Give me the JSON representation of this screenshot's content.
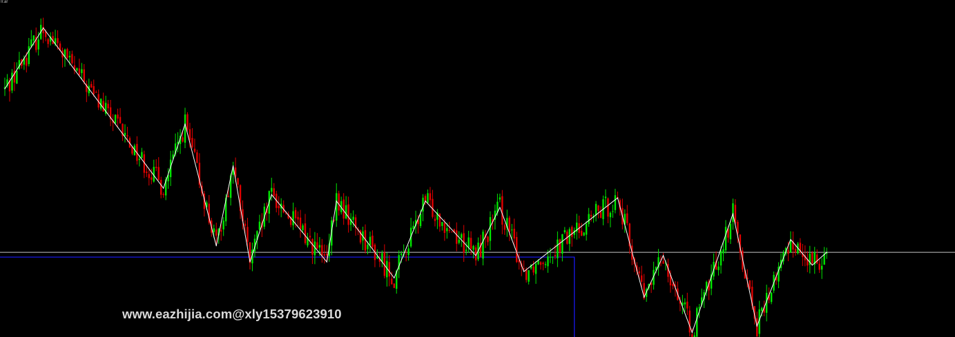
{
  "window": {
    "corner_label": "Ir.ar"
  },
  "watermark": {
    "text": "www.eazhijia.com@xly15379623910"
  },
  "colors": {
    "background": "#000000",
    "bull_candle": "#00e600",
    "bear_candle": "#e00000",
    "zigzag": "#ffffff",
    "horizontal_line": "#c8c8c8",
    "box_outline": "#1a1aff"
  },
  "chart_data": {
    "type": "candlestick",
    "title": "",
    "xlabel": "",
    "ylabel": "",
    "y_scale": "price (unlabeled)",
    "ylim": [
      0,
      100
    ],
    "grid": false,
    "legend": "none",
    "overlays": {
      "zigzag_pivots": [
        {
          "bar": 0,
          "value": 77
        },
        {
          "bar": 16,
          "value": 96
        },
        {
          "bar": 66,
          "value": 46
        },
        {
          "bar": 75,
          "value": 66
        },
        {
          "bar": 88,
          "value": 28
        },
        {
          "bar": 95,
          "value": 53
        },
        {
          "bar": 102,
          "value": 23
        },
        {
          "bar": 111,
          "value": 44
        },
        {
          "bar": 134,
          "value": 23
        },
        {
          "bar": 138,
          "value": 42
        },
        {
          "bar": 162,
          "value": 18
        },
        {
          "bar": 175,
          "value": 42
        },
        {
          "bar": 196,
          "value": 25
        },
        {
          "bar": 206,
          "value": 40
        },
        {
          "bar": 216,
          "value": 20
        },
        {
          "bar": 255,
          "value": 43
        },
        {
          "bar": 266,
          "value": 12
        },
        {
          "bar": 274,
          "value": 25
        },
        {
          "bar": 286,
          "value": 1
        },
        {
          "bar": 303,
          "value": 38
        },
        {
          "bar": 313,
          "value": 3
        },
        {
          "bar": 327,
          "value": 30
        },
        {
          "bar": 336,
          "value": 22
        },
        {
          "bar": 342,
          "value": 26
        }
      ],
      "horizontal_level": 26,
      "box": {
        "from_bar": 0,
        "to_bar": 237,
        "top_value": 24.5
      }
    }
  }
}
